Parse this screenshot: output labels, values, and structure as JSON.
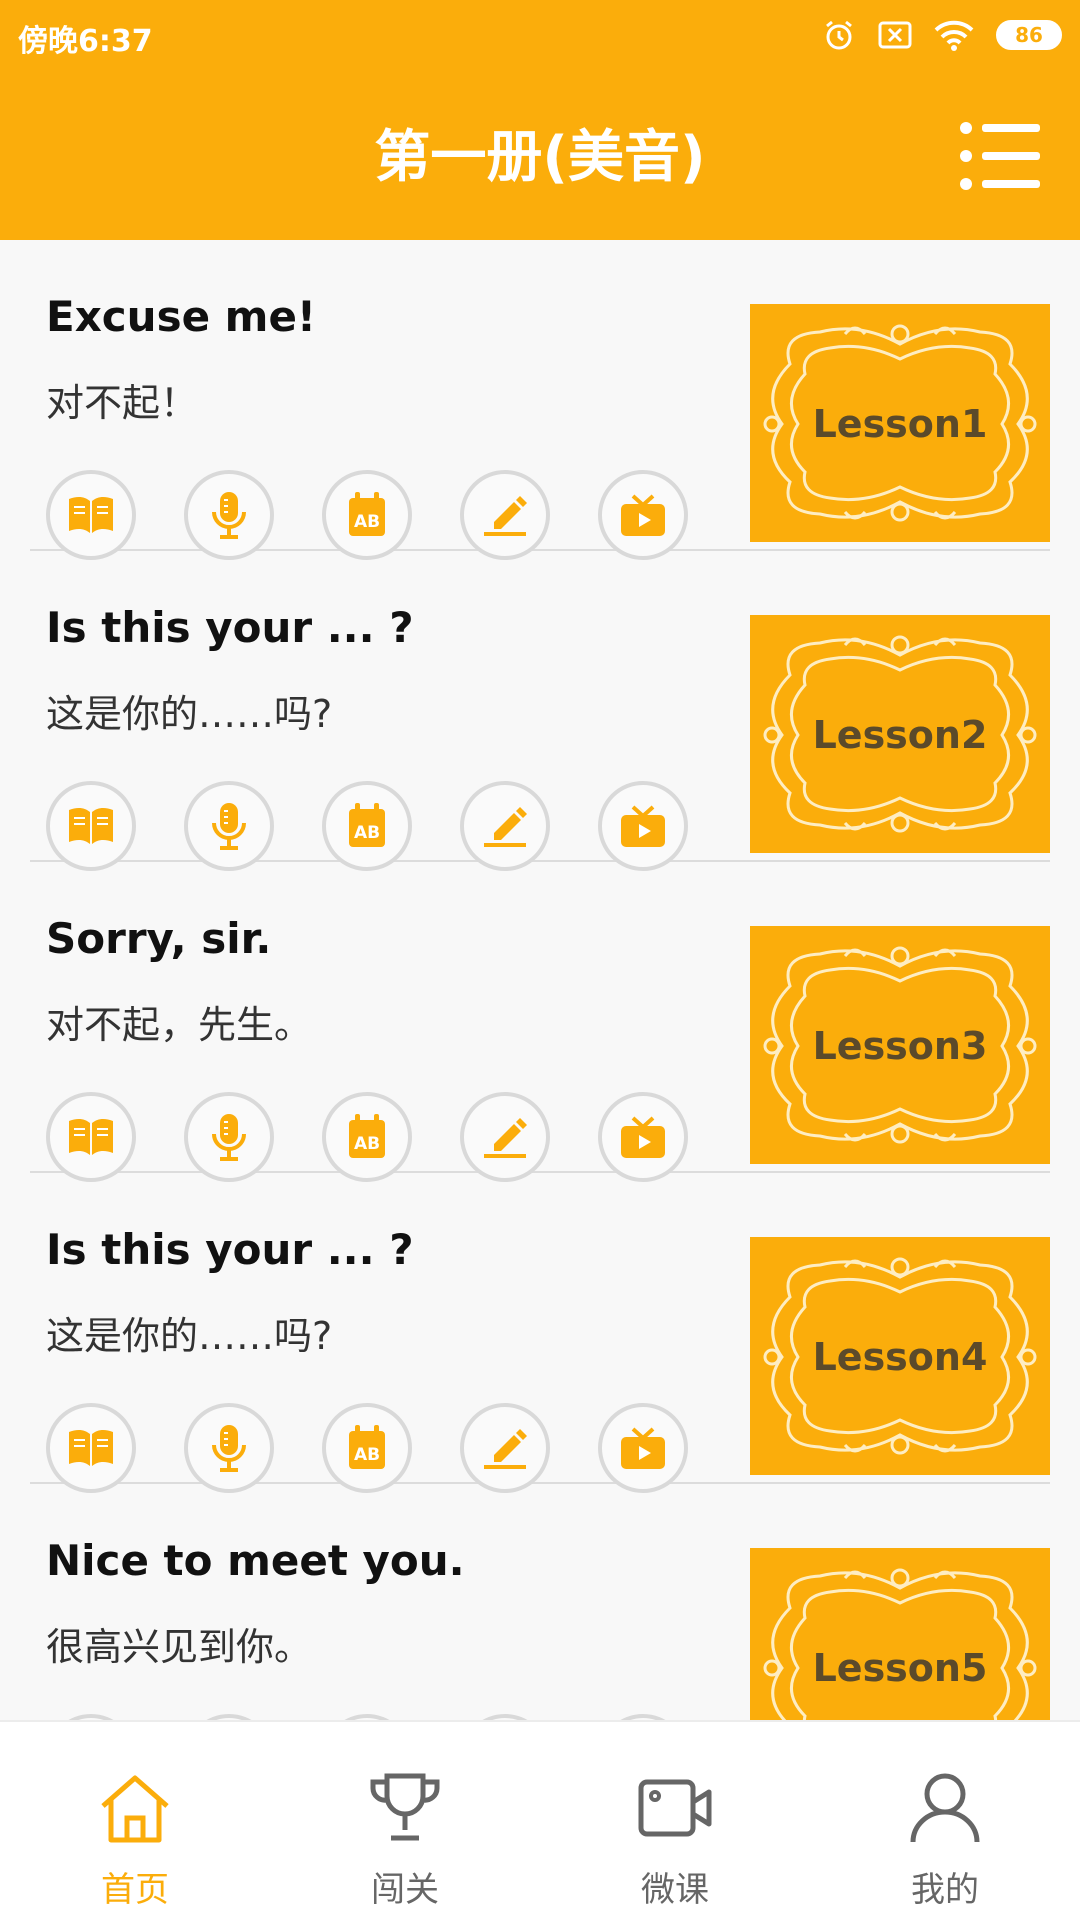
{
  "status": {
    "time": "傍晚6:37",
    "battery": "86",
    "icons": [
      "alarm-icon",
      "sim-off-icon",
      "wifi-icon",
      "battery-icon"
    ]
  },
  "header": {
    "title": "第一册(美音)",
    "menu_icon": "list-menu-icon"
  },
  "colors": {
    "accent": "#FBAD0B",
    "thumb_text": "#5b4a2a",
    "nav_inactive": "#666666"
  },
  "lessons": [
    {
      "en": "Excuse me!",
      "zh": "对不起！",
      "thumb": "Lesson1"
    },
    {
      "en": "Is this your ... ?",
      "zh": "这是你的……吗?",
      "thumb": "Lesson2"
    },
    {
      "en": "Sorry, sir.",
      "zh": "对不起，先生。",
      "thumb": "Lesson3"
    },
    {
      "en": "Is this your ... ?",
      "zh": "这是你的……吗?",
      "thumb": "Lesson4"
    },
    {
      "en": "Nice to meet you.",
      "zh": "很高兴见到你。",
      "thumb": "Lesson5"
    }
  ],
  "action_icons": [
    "book-icon",
    "microphone-icon",
    "ab-flashcard-icon",
    "pencil-edit-icon",
    "tv-play-icon"
  ],
  "nav": {
    "items": [
      {
        "label": "首页",
        "icon": "home-icon",
        "active": true
      },
      {
        "label": "闯关",
        "icon": "trophy-icon",
        "active": false
      },
      {
        "label": "微课",
        "icon": "video-camera-icon",
        "active": false
      },
      {
        "label": "我的",
        "icon": "user-icon",
        "active": false
      }
    ]
  }
}
